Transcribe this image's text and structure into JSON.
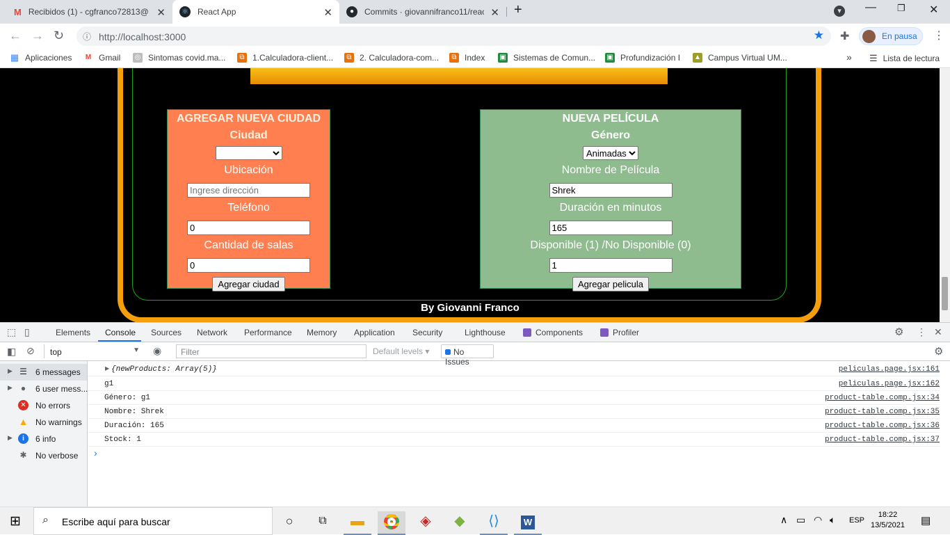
{
  "tabs": [
    {
      "title": "Recibidos (1) - cgfranco72813@u",
      "icon": "gmail-icon",
      "active": false
    },
    {
      "title": "React App",
      "icon": "react-icon",
      "active": true
    },
    {
      "title": "Commits · giovannifranco11/reac",
      "icon": "github-icon",
      "active": false
    }
  ],
  "toolbar": {
    "url": "http://localhost:3000",
    "profile_label": "En pausa"
  },
  "bookmarks": {
    "items": [
      {
        "label": "Aplicaciones",
        "icon": "apps-icon",
        "color": "#4285f4"
      },
      {
        "label": "Gmail",
        "icon": "gmail-icon",
        "color": "#ea4335"
      },
      {
        "label": "Sintomas covid.ma...",
        "icon": "globe-icon",
        "color": "#5f6368"
      },
      {
        "label": "1.Calculadora-client...",
        "icon": "codepen-icon",
        "color": "#e8710a"
      },
      {
        "label": "2. Calculadora-com...",
        "icon": "codepen-icon",
        "color": "#e8710a"
      },
      {
        "label": "Index",
        "icon": "codepen-icon",
        "color": "#e8710a"
      },
      {
        "label": "Sistemas de Comun...",
        "icon": "classroom-icon",
        "color": "#1e8e3e"
      },
      {
        "label": "Profundización I",
        "icon": "classroom-icon",
        "color": "#1e8e3e"
      },
      {
        "label": "Campus Virtual UM...",
        "icon": "campus-icon",
        "color": "#9e9d24"
      }
    ],
    "overflow": "»",
    "reading_list": "Lista de lectura"
  },
  "page": {
    "city_form": {
      "title": "AGREGAR NUEVA CIUDAD",
      "section": "Ciudad",
      "city_select_value": "",
      "location_label": "Ubicación",
      "location_placeholder": "Ingrese dirección",
      "phone_label": "Teléfono",
      "phone_value": "0",
      "rooms_label": "Cantidad de salas",
      "rooms_value": "0",
      "submit": "Agregar ciudad"
    },
    "movie_form": {
      "title": "NUEVA PELÍCULA",
      "section": "Género",
      "genre_value": "Animadas",
      "name_label": "Nombre de Película",
      "name_value": "Shrek",
      "duration_label": "Duración en minutos",
      "duration_value": "165",
      "available_label": "Disponible (1) /No Disponible (0)",
      "available_value": "1",
      "submit": "Agregar pelicula"
    },
    "footer": "By Giovanni Franco",
    "colors": {
      "frame": "#f5a00b",
      "city_panel": "#ff7f50",
      "movie_panel": "#8fbc8f"
    }
  },
  "devtools": {
    "tabs": [
      "Elements",
      "Console",
      "Sources",
      "Network",
      "Performance",
      "Memory",
      "Application",
      "Security",
      "Lighthouse",
      "Components",
      "Profiler"
    ],
    "active_tab": "Console",
    "context": "top",
    "filter_placeholder": "Filter",
    "levels": "Default levels",
    "issues": "No Issues",
    "sidebar": [
      {
        "label": "6 messages",
        "icon": "list-icon",
        "expandable": true,
        "selected": true
      },
      {
        "label": "6 user mess...",
        "icon": "user-icon",
        "expandable": true,
        "selected": false
      },
      {
        "label": "No errors",
        "icon": "error-icon",
        "expandable": false,
        "selected": false
      },
      {
        "label": "No warnings",
        "icon": "warning-icon",
        "expandable": false,
        "selected": false
      },
      {
        "label": "6 info",
        "icon": "info-icon",
        "expandable": true,
        "selected": false
      },
      {
        "label": "No verbose",
        "icon": "bug-icon",
        "expandable": false,
        "selected": false
      }
    ],
    "console_rows": [
      {
        "text": "{newProducts: Array(5)}",
        "source": "peliculas.page.jsx:161",
        "expandable": true
      },
      {
        "text": "g1",
        "source": "peliculas.page.jsx:162",
        "expandable": false
      },
      {
        "text": "Género: g1",
        "source": "product-table.comp.jsx:34",
        "expandable": false
      },
      {
        "text": "Nombre: Shrek",
        "source": "product-table.comp.jsx:35",
        "expandable": false
      },
      {
        "text": "Duración: 165",
        "source": "product-table.comp.jsx:36",
        "expandable": false
      },
      {
        "text": "Stock: 1",
        "source": "product-table.comp.jsx:37",
        "expandable": false
      }
    ],
    "prompt": "›"
  },
  "taskbar": {
    "search_placeholder": "Escribe aquí para buscar",
    "lang": "ESP",
    "time": "18:22",
    "date": "13/5/2021"
  }
}
